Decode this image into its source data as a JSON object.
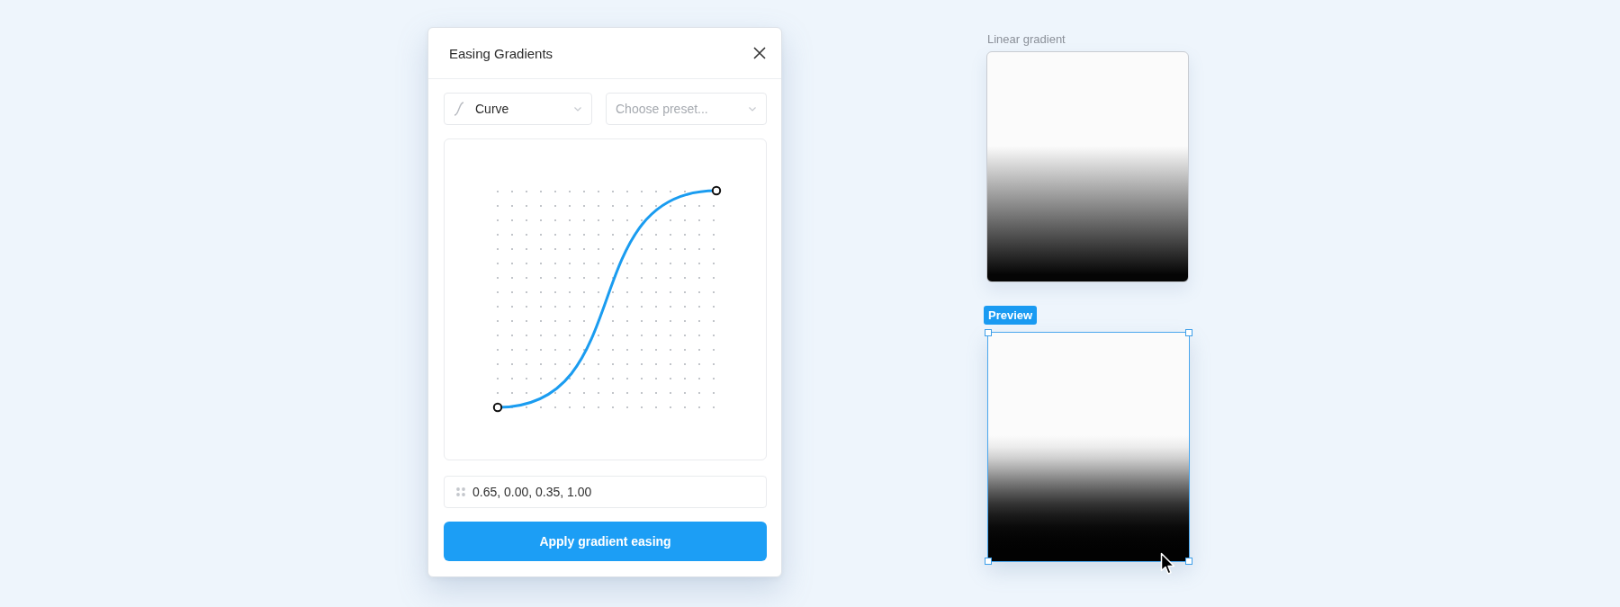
{
  "dialog": {
    "title": "Easing Gradients",
    "mode_dropdown": {
      "value": "Curve"
    },
    "preset_dropdown": {
      "placeholder": "Choose preset..."
    },
    "bezier_field": {
      "value": "0.65, 0.00, 0.35, 1.00"
    },
    "apply_button": {
      "label": "Apply gradient easing"
    }
  },
  "linear_gradient": {
    "label": "Linear gradient"
  },
  "preview": {
    "badge": "Preview",
    "selected": true
  }
}
